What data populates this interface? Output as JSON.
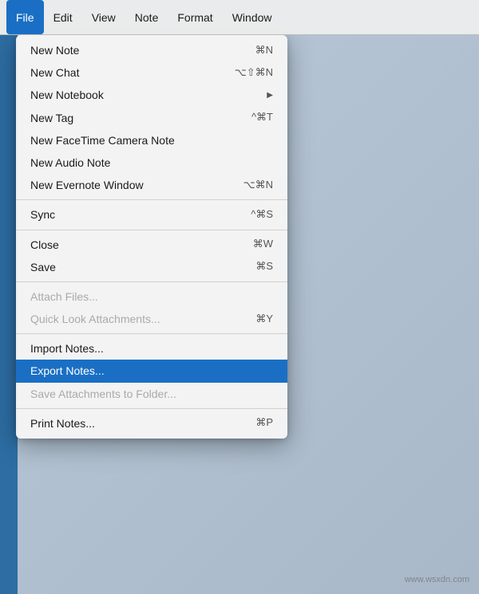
{
  "menubar": {
    "items": [
      {
        "label": "File",
        "active": true
      },
      {
        "label": "Edit",
        "active": false
      },
      {
        "label": "View",
        "active": false
      },
      {
        "label": "Note",
        "active": false
      },
      {
        "label": "Format",
        "active": false
      },
      {
        "label": "Window",
        "active": false
      }
    ]
  },
  "dropdown": {
    "items": [
      {
        "id": "new-note",
        "label": "New Note",
        "shortcut": "⌘N",
        "disabled": false,
        "separator_after": false,
        "arrow": false
      },
      {
        "id": "new-chat",
        "label": "New Chat",
        "shortcut": "⌥⇧⌘N",
        "disabled": false,
        "separator_after": false,
        "arrow": false
      },
      {
        "id": "new-notebook",
        "label": "New Notebook",
        "shortcut": "",
        "disabled": false,
        "separator_after": false,
        "arrow": true
      },
      {
        "id": "new-tag",
        "label": "New Tag",
        "shortcut": "^⌘T",
        "disabled": false,
        "separator_after": false,
        "arrow": false
      },
      {
        "id": "new-facetime",
        "label": "New FaceTime Camera Note",
        "shortcut": "",
        "disabled": false,
        "separator_after": false,
        "arrow": false
      },
      {
        "id": "new-audio",
        "label": "New Audio Note",
        "shortcut": "",
        "disabled": false,
        "separator_after": false,
        "arrow": false
      },
      {
        "id": "new-window",
        "label": "New Evernote Window",
        "shortcut": "⌥⌘N",
        "disabled": false,
        "separator_after": true,
        "arrow": false
      },
      {
        "id": "sync",
        "label": "Sync",
        "shortcut": "^⌘S",
        "disabled": false,
        "separator_after": true,
        "arrow": false
      },
      {
        "id": "close",
        "label": "Close",
        "shortcut": "⌘W",
        "disabled": false,
        "separator_after": false,
        "arrow": false
      },
      {
        "id": "save",
        "label": "Save",
        "shortcut": "⌘S",
        "disabled": false,
        "separator_after": true,
        "arrow": false
      },
      {
        "id": "attach-files",
        "label": "Attach Files...",
        "shortcut": "",
        "disabled": true,
        "separator_after": false,
        "arrow": false
      },
      {
        "id": "quick-look",
        "label": "Quick Look Attachments...",
        "shortcut": "⌘Y",
        "disabled": true,
        "separator_after": true,
        "arrow": false
      },
      {
        "id": "import-notes",
        "label": "Import Notes...",
        "shortcut": "",
        "disabled": false,
        "separator_after": false,
        "arrow": false
      },
      {
        "id": "export-notes",
        "label": "Export Notes...",
        "shortcut": "",
        "disabled": false,
        "highlighted": true,
        "separator_after": false,
        "arrow": false
      },
      {
        "id": "save-attachments",
        "label": "Save Attachments to Folder...",
        "shortcut": "",
        "disabled": true,
        "separator_after": true,
        "arrow": false
      },
      {
        "id": "print-notes",
        "label": "Print Notes...",
        "shortcut": "⌘P",
        "disabled": false,
        "separator_after": false,
        "arrow": false
      }
    ]
  },
  "watermark": {
    "text": "www.wsxdn.com"
  }
}
